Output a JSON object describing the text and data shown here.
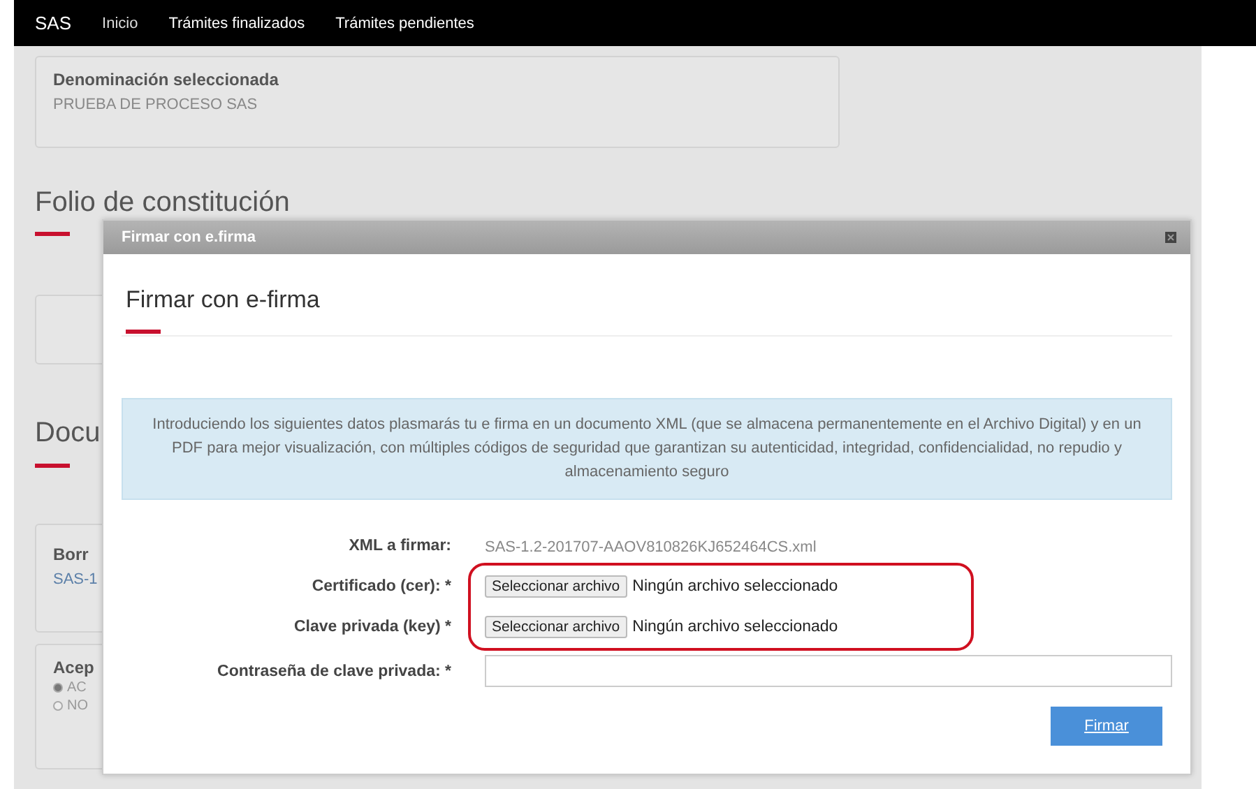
{
  "nav": {
    "brand": "SAS",
    "links": [
      "Inicio",
      "Trámites finalizados",
      "Trámites pendientes"
    ]
  },
  "background": {
    "denomination_card": {
      "label": "Denominación seleccionada",
      "value": "PRUEBA DE PROCESO SAS"
    },
    "folio_heading": "Folio de constitución",
    "documents_heading": "Docu",
    "draft_card": {
      "label": "Borr",
      "value": "SAS-1"
    },
    "accept_card": {
      "label": "Acep",
      "options": [
        {
          "label": "AC",
          "selected": true
        },
        {
          "label": "NO",
          "selected": false
        }
      ]
    }
  },
  "modal": {
    "title_bar": "Firmar con e.firma",
    "heading": "Firmar con e-firma",
    "info": "Introduciendo los siguientes datos plasmarás tu e firma en un documento XML (que se almacena permanentemente en el Archivo Digital) y en un PDF para mejor visualización, con múltiples códigos de seguridad que garantizan su autenticidad, integridad, confidencialidad, no repudio y almacenamiento seguro",
    "fields": [
      {
        "kind": "text",
        "label": "XML a firmar:",
        "value": "SAS-1.2-201707-AAOV810826KJ652464CS.xml"
      },
      {
        "kind": "file",
        "label": "Certificado (cer): *",
        "button": "Seleccionar archivo",
        "status": "Ningún archivo seleccionado"
      },
      {
        "kind": "file",
        "label": "Clave privada (key) *",
        "button": "Seleccionar archivo",
        "status": "Ningún archivo seleccionado"
      },
      {
        "kind": "password",
        "label": "Contraseña de clave privada: *"
      }
    ],
    "submit": "Firmar"
  }
}
